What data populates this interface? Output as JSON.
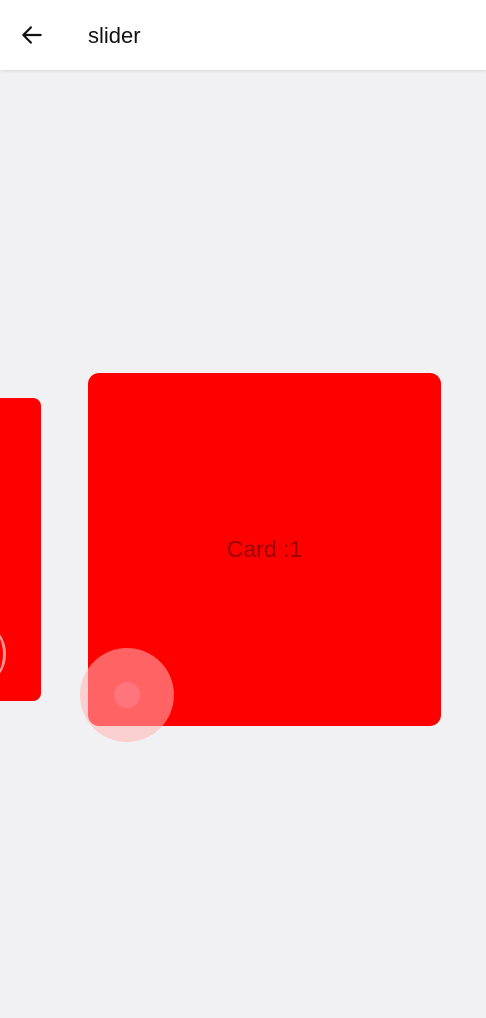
{
  "appbar": {
    "title": "slider",
    "back_icon": "arrow-left-icon"
  },
  "slider": {
    "cards": [
      {
        "label": "Card :1",
        "color": "#ff0000"
      }
    ],
    "card_color": "#ff0000",
    "background": "#f1f0f2"
  }
}
